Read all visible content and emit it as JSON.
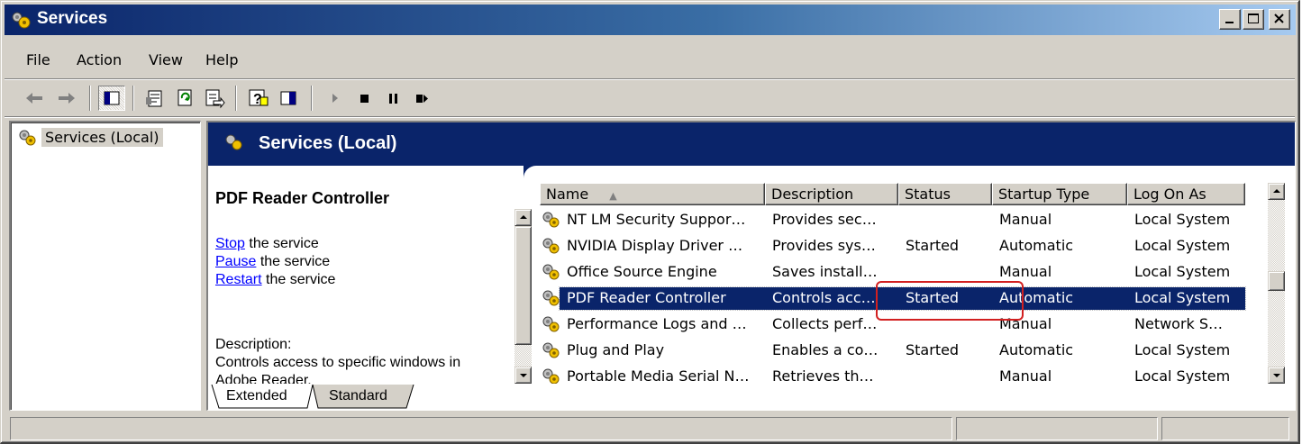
{
  "window": {
    "title": "Services",
    "minimize": "_",
    "maximize": "□",
    "close": "×"
  },
  "menu": {
    "file": "File",
    "action": "Action",
    "view": "View",
    "help": "Help"
  },
  "toolbar": {
    "icons": [
      "back-arrow-icon",
      "forward-arrow-icon",
      "show-hide-tree-icon",
      "properties-icon",
      "refresh-icon",
      "export-list-icon",
      "help-icon",
      "show-hide-action-pane-icon",
      "start-service-icon",
      "stop-service-icon",
      "pause-service-icon",
      "restart-service-icon"
    ]
  },
  "tree": {
    "root_label": "Services (Local)"
  },
  "banner": {
    "title": "Services (Local)"
  },
  "details": {
    "service_name": "PDF Reader Controller",
    "stop_link": "Stop",
    "stop_suffix": " the service",
    "pause_link": "Pause",
    "pause_suffix": " the service",
    "restart_link": "Restart",
    "restart_suffix": " the service",
    "description_label": "Description:",
    "description_text": "Controls access to specific windows in",
    "description_text_2": "Adobe Reader."
  },
  "list": {
    "columns": [
      "Name",
      "Description",
      "Status",
      "Startup Type",
      "Log On As"
    ],
    "sort_indicator": "▲",
    "rows": [
      {
        "name": "NT LM Security Suppor…",
        "description": "Provides sec…",
        "status": "",
        "startup": "Manual",
        "logon": "Local System"
      },
      {
        "name": "NVIDIA Display Driver …",
        "description": "Provides sys…",
        "status": "Started",
        "startup": "Automatic",
        "logon": "Local System"
      },
      {
        "name": "Office Source Engine",
        "description": "Saves install…",
        "status": "",
        "startup": "Manual",
        "logon": "Local System"
      },
      {
        "name": "PDF Reader Controller",
        "description": "Controls acc…",
        "status": "Started",
        "startup": "Automatic",
        "logon": "Local System"
      },
      {
        "name": "Performance Logs and …",
        "description": "Collects perf…",
        "status": "",
        "startup": "Manual",
        "logon": "Network S…"
      },
      {
        "name": "Plug and Play",
        "description": "Enables a co…",
        "status": "Started",
        "startup": "Automatic",
        "logon": "Local System"
      },
      {
        "name": "Portable Media Serial N…",
        "description": "Retrieves th…",
        "status": "",
        "startup": "Manual",
        "logon": "Local System"
      }
    ],
    "selected_row": "PDF Reader Controller"
  },
  "tabs": {
    "extended": "Extended",
    "standard": "Standard"
  },
  "colors": {
    "title_gradient_start": "#0a246a",
    "title_gradient_end": "#a6caf0",
    "selection": "#0a246a",
    "link": "#0000ff",
    "annotation": "#d22020",
    "face": "#d4d0c8"
  }
}
